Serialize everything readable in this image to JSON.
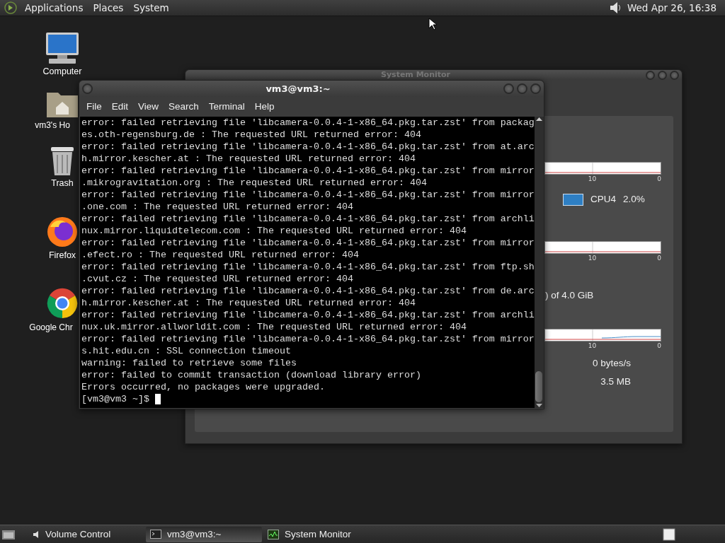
{
  "top_panel": {
    "menus": [
      {
        "label": "Applications"
      },
      {
        "label": "Places"
      },
      {
        "label": "System"
      }
    ],
    "clock": "Wed Apr 26, 16:38"
  },
  "desktop_icons": [
    {
      "kind": "computer",
      "label": "Computer"
    },
    {
      "kind": "home",
      "label": "vm3's Ho"
    },
    {
      "kind": "trash",
      "label": "Trash"
    },
    {
      "kind": "firefox",
      "label": "Firefox"
    },
    {
      "kind": "chrome",
      "label": "Google Chr"
    }
  ],
  "system_monitor": {
    "title": "System Monitor",
    "sections": [
      {
        "kind": "graph",
        "ticks": [
          "10",
          "0"
        ]
      },
      {
        "kind": "legend",
        "color": "#2e7fc4",
        "label": "CPU4",
        "value": "2.0%"
      },
      {
        "kind": "graph",
        "ticks": [
          "10",
          "0"
        ]
      },
      {
        "kind": "text",
        "text": ") of 4.0 GiB"
      },
      {
        "kind": "graph",
        "ticks": [
          "10",
          "0"
        ]
      },
      {
        "kind": "stat",
        "text": "0 bytes/s"
      },
      {
        "kind": "stat",
        "text": "3.5 MB"
      }
    ]
  },
  "terminal": {
    "title": "vm3@vm3:~",
    "menus": [
      "File",
      "Edit",
      "View",
      "Search",
      "Terminal",
      "Help"
    ],
    "lines": [
      "error: failed retrieving file 'libcamera-0.0.4-1-x86_64.pkg.tar.zst' from packag",
      "es.oth-regensburg.de : The requested URL returned error: 404",
      "error: failed retrieving file 'libcamera-0.0.4-1-x86_64.pkg.tar.zst' from at.arc",
      "h.mirror.kescher.at : The requested URL returned error: 404",
      "error: failed retrieving file 'libcamera-0.0.4-1-x86_64.pkg.tar.zst' from mirror",
      ".mikrogravitation.org : The requested URL returned error: 404",
      "error: failed retrieving file 'libcamera-0.0.4-1-x86_64.pkg.tar.zst' from mirror",
      ".one.com : The requested URL returned error: 404",
      "error: failed retrieving file 'libcamera-0.0.4-1-x86_64.pkg.tar.zst' from archli",
      "nux.mirror.liquidtelecom.com : The requested URL returned error: 404",
      "error: failed retrieving file 'libcamera-0.0.4-1-x86_64.pkg.tar.zst' from mirror",
      ".efect.ro : The requested URL returned error: 404",
      "error: failed retrieving file 'libcamera-0.0.4-1-x86_64.pkg.tar.zst' from ftp.sh",
      ".cvut.cz : The requested URL returned error: 404",
      "error: failed retrieving file 'libcamera-0.0.4-1-x86_64.pkg.tar.zst' from de.arc",
      "h.mirror.kescher.at : The requested URL returned error: 404",
      "error: failed retrieving file 'libcamera-0.0.4-1-x86_64.pkg.tar.zst' from archli",
      "nux.uk.mirror.allworldit.com : The requested URL returned error: 404",
      "error: failed retrieving file 'libcamera-0.0.4-1-x86_64.pkg.tar.zst' from mirror",
      "s.hit.edu.cn : SSL connection timeout",
      "warning: failed to retrieve some files",
      "error: failed to commit transaction (download library error)",
      "Errors occurred, no packages were upgraded."
    ],
    "prompt": "[vm3@vm3 ~]$"
  },
  "taskbar": {
    "tasks": [
      {
        "kind": "volume",
        "label": "Volume Control",
        "selected": false
      },
      {
        "kind": "terminal",
        "label": "vm3@vm3:~",
        "selected": true
      },
      {
        "kind": "monitor",
        "label": "System Monitor",
        "selected": false
      }
    ]
  }
}
